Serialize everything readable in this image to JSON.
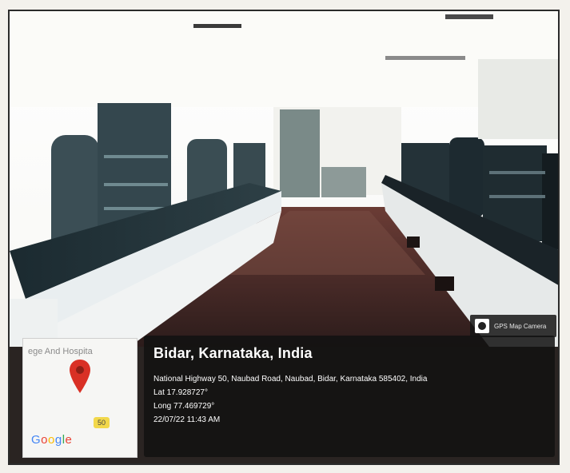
{
  "photo": {
    "camera_badge": {
      "icon": "gps-map-camera-icon",
      "label": "GPS Map Camera"
    }
  },
  "map_tile": {
    "label": "ege And Hospita",
    "route_badge": "50",
    "brand": "Google",
    "pin_icon": "map-pin-icon",
    "pin_color": "#d93025"
  },
  "geotag": {
    "place": "Bidar, Karnataka, India",
    "address": "National Highway 50, Naubad Road, Naubad, Bidar, Karnataka 585402, India",
    "lat": "Lat 17.928727°",
    "long": "Long 77.469729°",
    "timestamp": "22/07/22 11:43 AM"
  }
}
